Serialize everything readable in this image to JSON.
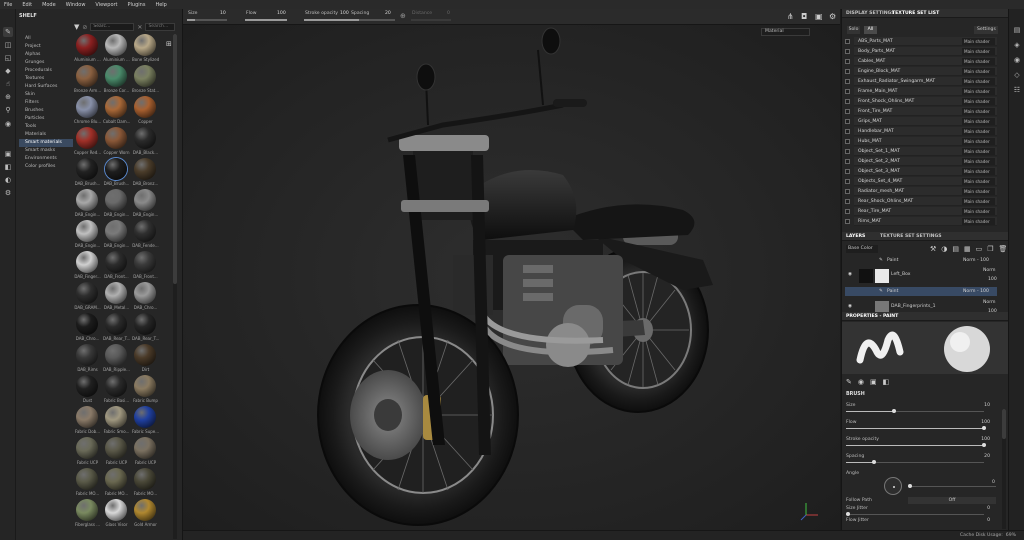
{
  "menu": [
    "File",
    "Edit",
    "Mode",
    "Window",
    "Viewport",
    "Plugins",
    "Help"
  ],
  "shelf": {
    "title": "SHELF",
    "search_placeholder": "Searc...",
    "search2_placeholder": "Search...",
    "categories": [
      "All",
      "Project",
      "Alphas",
      "Grunges",
      "Procedurals",
      "Textures",
      "Hard Surfaces",
      "Skin",
      "Filters",
      "Brushes",
      "Particles",
      "Tools",
      "Materials",
      "Smart materials",
      "Smart masks",
      "Environments",
      "Color profiles"
    ],
    "active_category": "Smart materials",
    "materials": [
      {
        "label": "Aluminium ...",
        "color": "#8a2020"
      },
      {
        "label": "Aluminium ...",
        "color": "#b8b8b8"
      },
      {
        "label": "Bone Stylized",
        "color": "#b8a888"
      },
      {
        "label": "Bronze Arm...",
        "color": "#8a6040"
      },
      {
        "label": "Bronze Cor...",
        "color": "#4a8a6a"
      },
      {
        "label": "Bronze Stat...",
        "color": "#7a8060"
      },
      {
        "label": "Chrome Blu...",
        "color": "#8890a8"
      },
      {
        "label": "Cobalt Dam...",
        "color": "#a86838"
      },
      {
        "label": "Copper",
        "color": "#a86030"
      },
      {
        "label": "Copper Red...",
        "color": "#a03028"
      },
      {
        "label": "Copper Worn",
        "color": "#8a5838"
      },
      {
        "label": "DAB_Black...",
        "color": "#2a2a2a"
      },
      {
        "label": "DAB_Brush...",
        "color": "#222222"
      },
      {
        "label": "DAB_Brush...",
        "color": "#1e1e1e"
      },
      {
        "label": "DAB_Bronz...",
        "color": "#4a3c2a"
      },
      {
        "label": "DAB_Engin...",
        "color": "#a8a8a8"
      },
      {
        "label": "DAB_Engin...",
        "color": "#6a6a6a"
      },
      {
        "label": "DAB_Engin...",
        "color": "#8a8a8a"
      },
      {
        "label": "DAB_Engin...",
        "color": "#c0c0c0"
      },
      {
        "label": "DAB_Engin...",
        "color": "#7a7a7a"
      },
      {
        "label": "DAB_Fende...",
        "color": "#303030"
      },
      {
        "label": "DAB_Finger...",
        "color": "#d0d0d0"
      },
      {
        "label": "DAB_Front...",
        "color": "#2c2c2c"
      },
      {
        "label": "DAB_Front...",
        "color": "#3a3a3a"
      },
      {
        "label": "DAB_GRAM...",
        "color": "#2e2e2e"
      },
      {
        "label": "DAB_Metal...",
        "color": "#b0b0b0"
      },
      {
        "label": "DAB_Chro...",
        "color": "#9a9a9a"
      },
      {
        "label": "DAB_Chro...",
        "color": "#1c1c1c"
      },
      {
        "label": "DAB_Rear_T...",
        "color": "#2a2a2a"
      },
      {
        "label": "DAB_Rear_T...",
        "color": "#262626"
      },
      {
        "label": "DAB_Rims",
        "color": "#383838"
      },
      {
        "label": "DAB_Ripple...",
        "color": "#5a5a5a"
      },
      {
        "label": "Dirt",
        "color": "#4a3a28"
      },
      {
        "label": "Dust",
        "color": "#202020"
      },
      {
        "label": "Fabric Basi...",
        "color": "#2a2a2a"
      },
      {
        "label": "Fabric Bump",
        "color": "#8a7a60"
      },
      {
        "label": "Fabric Dob...",
        "color": "#8a7a68"
      },
      {
        "label": "Fabric Smo...",
        "color": "#a09880"
      },
      {
        "label": "Fabric Supe...",
        "color": "#2040a0"
      },
      {
        "label": "Fabric UCP",
        "color": "#6a6a58"
      },
      {
        "label": "Fabric UCP",
        "color": "#5a5848"
      },
      {
        "label": "Fabric UCP",
        "color": "#7a7060"
      },
      {
        "label": "Fabric MO...",
        "color": "#5a5a48"
      },
      {
        "label": "Fabric MO...",
        "color": "#6a6850"
      },
      {
        "label": "Fabric MO...",
        "color": "#4a4838"
      },
      {
        "label": "Fiberglass ...",
        "color": "#7a8a60"
      },
      {
        "label": "Glass Visor",
        "color": "#d8d8d8"
      },
      {
        "label": "Gold Armor",
        "color": "#b08830"
      }
    ],
    "selected_index": 13
  },
  "options": {
    "size_label": "Size",
    "size_value": "10",
    "size_fraction": 0.2,
    "flow_label": "Flow",
    "flow_value": "100",
    "flow_fraction": 1.0,
    "opacity_label": "Stroke opacity",
    "opacity_value": "100",
    "opacity_fraction": 1.0,
    "spacing_label": "Spacing",
    "spacing_value": "20",
    "spacing_fraction": 0.2,
    "distance_label": "Distance",
    "distance_value": "0"
  },
  "viewport": {
    "channel": "Material",
    "cache_label": "Cache Disk Usage:",
    "cache_value": "69%"
  },
  "display_panel": {
    "tab1": "DISPLAY SETTINGS",
    "tab2": "TEXTURE SET LIST",
    "solo": "Solo",
    "all": "All",
    "settings": "Settings",
    "texture_sets": [
      "ABS_Parts_MAT",
      "Body_Parts_MAT",
      "Cables_MAT",
      "Engine_Block_MAT",
      "Exhaust_Radiator_Swingarm_MAT",
      "Frame_Main_MAT",
      "Front_Shock_Ohlins_MAT",
      "Front_Tire_MAT",
      "Grips_MAT",
      "Handlebar_MAT",
      "Hubs_MAT",
      "Object_Set_1_MAT",
      "Object_Set_2_MAT",
      "Object_Set_3_MAT",
      "Objects_Set_4_MAT",
      "Radiator_mesh_MAT",
      "Rear_Shock_Ohlins_MAT",
      "Rear_Tire_MAT",
      "Rims_MAT"
    ],
    "shader": "Main shader"
  },
  "layers_panel": {
    "tab1": "LAYERS",
    "tab2": "TEXTURE SET SETTINGS",
    "channel": "Base Color",
    "rows": [
      {
        "name": "Paint",
        "blend": "Norm",
        "opacity": "100"
      },
      {
        "name": "Left_Box",
        "blend": "Norm",
        "opacity": "100"
      },
      {
        "name": "Paint",
        "blend": "Norm",
        "opacity": "100"
      },
      {
        "name": "DAB_Fingerprints_1",
        "blend": "Norm",
        "opacity": "100"
      }
    ]
  },
  "properties": {
    "title": "PROPERTIES - PAINT",
    "section": "BRUSH",
    "size_label": "Size",
    "size_value": "10",
    "size_fraction": 0.35,
    "flow_label": "Flow",
    "flow_value": "100",
    "flow_fraction": 1.0,
    "opacity_label": "Stroke opacity",
    "opacity_value": "100",
    "opacity_fraction": 1.0,
    "spacing_label": "Spacing",
    "spacing_value": "20",
    "spacing_fraction": 0.2,
    "angle_label": "Angle",
    "angle_value": "0",
    "follow_label": "Follow Path",
    "follow_value": "Off",
    "size_jitter_label": "Size Jitter",
    "size_jitter_value": "0",
    "flow_jitter_label": "Flow Jitter",
    "flow_jitter_value": "0"
  },
  "icons": {
    "tools": [
      "paint-brush-icon",
      "eraser-icon",
      "projection-icon",
      "polygon-fill-icon",
      "smudge-icon",
      "clone-icon",
      "picker-icon",
      "material-picker-icon"
    ],
    "right_strip": [
      "texture-set-icon",
      "display-settings-icon",
      "shader-settings-icon",
      "bake-icon",
      "history-icon"
    ]
  }
}
